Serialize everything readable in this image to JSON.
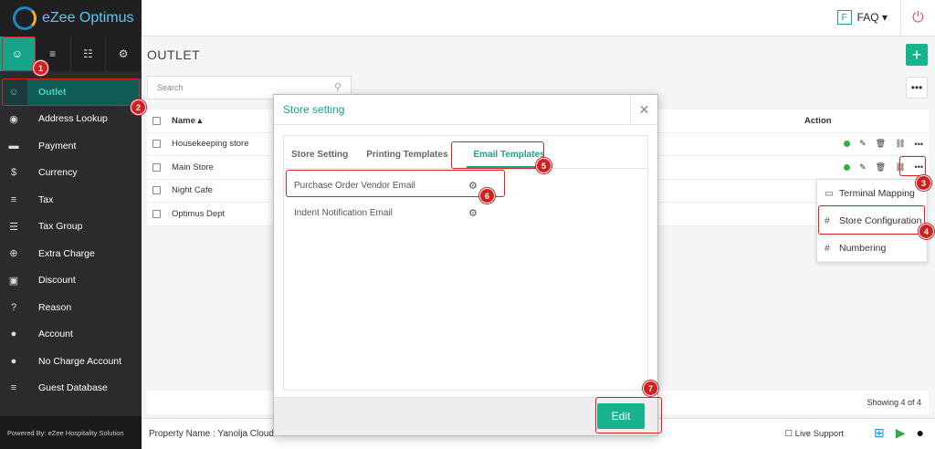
{
  "brand": {
    "name": "eZee Optimus"
  },
  "sidebar": {
    "tabs": [
      {
        "icon": "user-icon",
        "glyph": "☺"
      },
      {
        "icon": "menu-icon",
        "glyph": "≡"
      },
      {
        "icon": "cart-icon",
        "glyph": "☷"
      },
      {
        "icon": "gear-icon",
        "glyph": "⚙"
      }
    ],
    "items": [
      {
        "label": "Outlet",
        "icon": "user-icon",
        "glyph": "☺"
      },
      {
        "label": "Address Lookup",
        "icon": "location-icon",
        "glyph": "◉"
      },
      {
        "label": "Payment",
        "icon": "card-icon",
        "glyph": "▬"
      },
      {
        "label": "Currency",
        "icon": "dollar-icon",
        "glyph": "$"
      },
      {
        "label": "Tax",
        "icon": "list-icon",
        "glyph": "≡"
      },
      {
        "label": "Tax Group",
        "icon": "list-icon",
        "glyph": "☰"
      },
      {
        "label": "Extra Charge",
        "icon": "plus-circle-icon",
        "glyph": "⊕"
      },
      {
        "label": "Discount",
        "icon": "gift-icon",
        "glyph": "▣"
      },
      {
        "label": "Reason",
        "icon": "question-icon",
        "glyph": "?"
      },
      {
        "label": "Account",
        "icon": "user-icon",
        "glyph": "●"
      },
      {
        "label": "No Charge Account",
        "icon": "user-icon",
        "glyph": "●"
      },
      {
        "label": "Guest Database",
        "icon": "database-icon",
        "glyph": "≡"
      }
    ],
    "powered_by": "Powered By: eZee Hospitality Solution"
  },
  "header": {
    "faq_badge": "F",
    "faq_label": "FAQ ▾",
    "power_icon": "power-icon"
  },
  "main": {
    "title": "OUTLET",
    "search_placeholder": "Search",
    "table": {
      "col_name": "Name ▴",
      "col_action": "Action",
      "rows": [
        "Housekeeping store",
        "Main Store",
        "Night Cafe",
        "Optimus Dept"
      ]
    },
    "showing": "Showing 4 of 4"
  },
  "row_menu": {
    "items": [
      {
        "label": "Terminal Mapping",
        "glyph": "▭"
      },
      {
        "label": "Store Configuration",
        "glyph": "#"
      },
      {
        "label": "Numbering",
        "glyph": "#"
      }
    ]
  },
  "modal": {
    "title": "Store setting",
    "tabs": [
      "Store Setting",
      "Printing Templates",
      "Email Templates"
    ],
    "templates": [
      "Purchase Order Vendor Email",
      "Indent Notification Email"
    ],
    "edit_label": "Edit"
  },
  "bottom": {
    "property": "Property Name : Yanolja Cloud",
    "live_support": "☐ Live Support"
  },
  "callouts": [
    "1",
    "2",
    "3",
    "4",
    "5",
    "6",
    "7"
  ]
}
